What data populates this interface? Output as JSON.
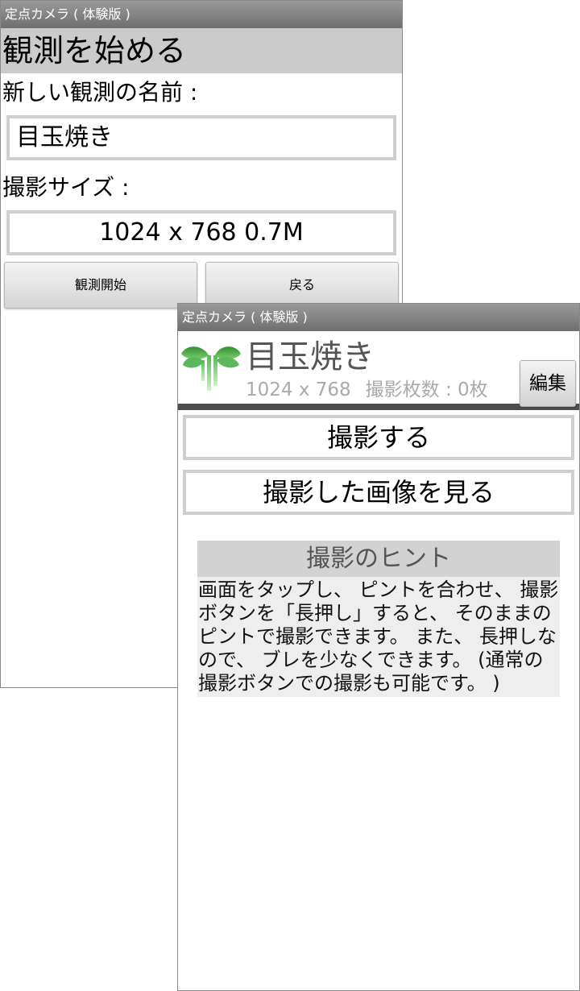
{
  "screen1": {
    "title_bar": "定点カメラ ( 体験版 )",
    "heading": "観測を始める",
    "name_label": "新しい観測の名前 :",
    "name_value": "目玉焼き",
    "size_label": "撮影サイズ :",
    "size_value": "1024 x 768   0.7M",
    "start_button": "観測開始",
    "back_button": "戻る"
  },
  "screen2": {
    "title_bar": "定点カメラ ( 体験版 )",
    "observation_name": "目玉焼き",
    "resolution": "1024 x 768",
    "shot_count": "撮影枚数 :  0枚",
    "edit_button": "編集",
    "shoot_button": "撮影する",
    "view_button": "撮影した画像を見る",
    "hint_title": "撮影のヒント",
    "hint_text": "画面をタップし、 ピントを合わせ、 撮影ボタンを「長押し」すると、 そのままのピントで撮影できます。 また、 長押しなので、 ブレを少なくできます。 (通常の撮影ボタンでの撮影も可能です。 )",
    "logo_icon": "sprout-icon"
  },
  "colors": {
    "title_bar": "#7f7f7f",
    "heading_bg": "#cbcbcb",
    "field_border": "#cfcfcf",
    "divider": "#4d4d4d",
    "hint_title_bg": "#d2d2d2",
    "hint_body_bg": "#eeeeee",
    "sprout_green": "#3aa63a"
  }
}
